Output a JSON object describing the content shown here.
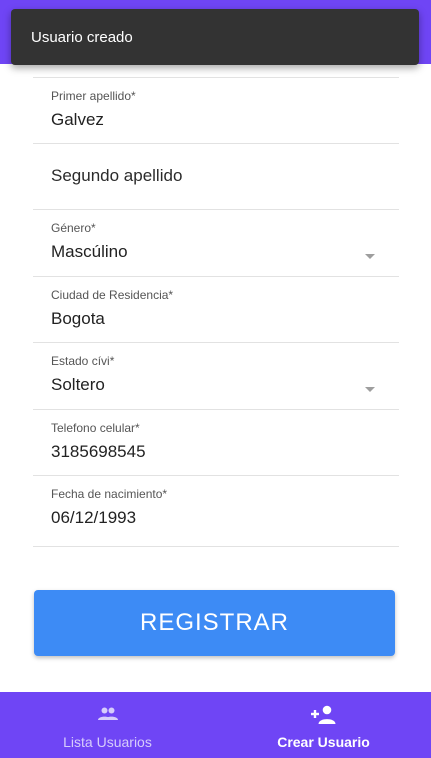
{
  "snackbar": {
    "message": "Usuario creado"
  },
  "form": {
    "fields": [
      {
        "label": "Primer apellido*",
        "value": "Galvez"
      },
      {
        "placeholder": "Segundo apellido"
      },
      {
        "label": "Género*",
        "value": "Mascúlino"
      },
      {
        "label": "Ciudad de Residencia*",
        "value": "Bogota"
      },
      {
        "label": "Estado cívi*",
        "value": "Soltero"
      },
      {
        "label": "Telefono celular*",
        "value": "3185698545"
      },
      {
        "label": "Fecha de nacimiento*",
        "value": "06/12/1993"
      }
    ],
    "submit_label": "REGISTRAR"
  },
  "bottom_nav": {
    "items": [
      {
        "label": "Lista Usuarios",
        "icon": "group-icon"
      },
      {
        "label": "Crear Usuario",
        "icon": "person-add-icon",
        "active": true
      }
    ]
  },
  "colors": {
    "accent": "#6f45f5",
    "button": "#3d8bf5",
    "snackbar": "#333333"
  }
}
